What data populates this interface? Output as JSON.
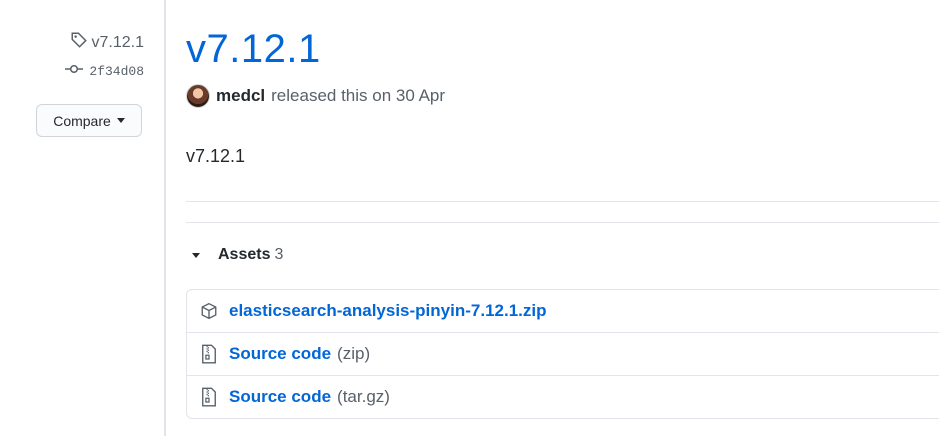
{
  "sidebar": {
    "tag": "v7.12.1",
    "commit": "2f34d08",
    "compare_label": "Compare"
  },
  "release": {
    "title": "v7.12.1",
    "author": "medcl",
    "released_text": "released this on 30 Apr",
    "body": "v7.12.1"
  },
  "assets": {
    "title": "Assets",
    "count": "3",
    "items": [
      {
        "name": "elasticsearch-analysis-pinyin-7.12.1.zip",
        "suffix": "",
        "icon": "package-icon"
      },
      {
        "name": "Source code",
        "suffix": "(zip)",
        "icon": "file-zip-icon"
      },
      {
        "name": "Source code",
        "suffix": "(tar.gz)",
        "icon": "file-zip-icon"
      }
    ]
  },
  "colors": {
    "link": "#0366d6",
    "muted": "#586069",
    "border": "#e1e4e8"
  }
}
